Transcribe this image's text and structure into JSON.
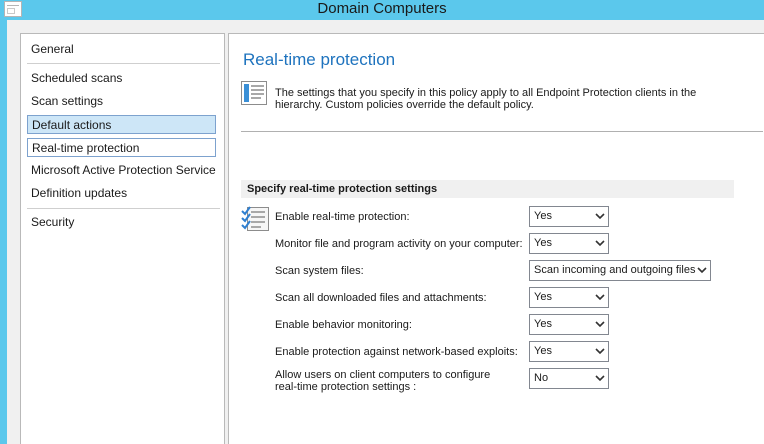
{
  "window": {
    "title": "Domain Computers"
  },
  "nav": {
    "items": [
      {
        "label": "General"
      },
      {
        "label": "Scheduled scans"
      },
      {
        "label": "Scan settings"
      },
      {
        "label": "Default actions"
      },
      {
        "label": "Real-time protection"
      },
      {
        "label": "Microsoft Active Protection Service"
      },
      {
        "label": "Definition updates"
      },
      {
        "label": "Security"
      }
    ],
    "selected": "Default actions",
    "focused": "Real-time protection"
  },
  "page": {
    "title": "Real-time protection",
    "description": "The settings that you specify in this policy apply to all Endpoint Protection clients in the hierarchy. Custom policies override the default policy."
  },
  "section": {
    "title": "Specify real-time protection settings"
  },
  "settings": [
    {
      "label": "Enable real-time protection:",
      "value": "Yes"
    },
    {
      "label": "Monitor file and program activity on your computer:",
      "value": "Yes"
    },
    {
      "label": "Scan system files:",
      "value": "Scan incoming and outgoing files"
    },
    {
      "label": "Scan all downloaded files and attachments:",
      "value": "Yes"
    },
    {
      "label": "Enable behavior monitoring:",
      "value": "Yes"
    },
    {
      "label": "Enable protection against network-based exploits:",
      "value": "Yes"
    },
    {
      "label": "Allow users on client computers to configure real-time protection settings :",
      "value": "No"
    }
  ]
}
